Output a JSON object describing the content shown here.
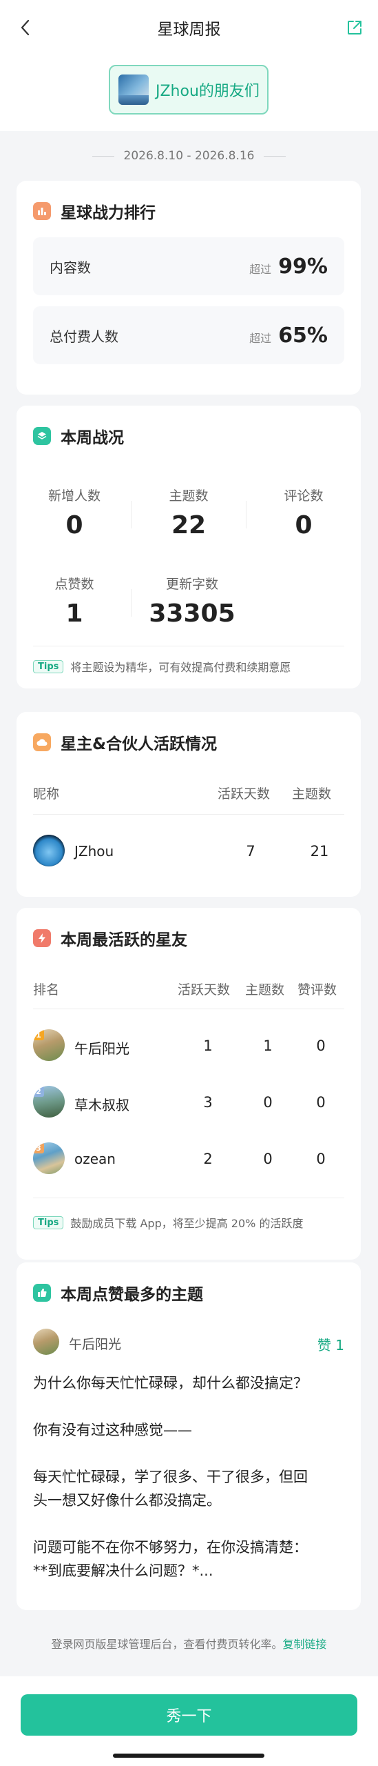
{
  "header": {
    "title": "星球周报",
    "back_icon": "chevron-left-icon",
    "share_icon": "share-external-icon"
  },
  "group": {
    "name": "JZhou的朋友们"
  },
  "date_range": "2026.8.10 - 2026.8.16",
  "ranking": {
    "title": "星球战力排行",
    "rows": [
      {
        "label": "内容数",
        "over": "超过",
        "pct": "99%"
      },
      {
        "label": "总付费人数",
        "over": "超过",
        "pct": "65%"
      }
    ]
  },
  "weekly": {
    "title": "本周战况",
    "stats": [
      {
        "label": "新增人数",
        "value": "0"
      },
      {
        "label": "主题数",
        "value": "22"
      },
      {
        "label": "评论数",
        "value": "0"
      },
      {
        "label": "点赞数",
        "value": "1"
      },
      {
        "label": "更新字数",
        "value": "33305"
      }
    ],
    "tip_tag": "Tips",
    "tip_text": "将主题设为精华，可有效提高付费和续期意愿"
  },
  "activity": {
    "title": "星主&合伙人活跃情况",
    "headers": {
      "name": "昵称",
      "days": "活跃天数",
      "topics": "主题数"
    },
    "rows": [
      {
        "name": "JZhou",
        "days": "7",
        "topics": "21"
      }
    ]
  },
  "active_members": {
    "title": "本周最活跃的星友",
    "headers": {
      "rank": "排名",
      "days": "活跃天数",
      "topics": "主题数",
      "likes": "赞评数"
    },
    "rows": [
      {
        "rank": "1",
        "name": "午后阳光",
        "days": "1",
        "topics": "1",
        "likes": "0"
      },
      {
        "rank": "2",
        "name": "草木叔叔",
        "days": "3",
        "topics": "0",
        "likes": "0"
      },
      {
        "rank": "3",
        "name": "ozean",
        "days": "2",
        "topics": "0",
        "likes": "0"
      }
    ],
    "tip_tag": "Tips",
    "tip_text": "鼓励成员下载 App，将至少提高 20% 的活跃度"
  },
  "top_post": {
    "title": "本周点赞最多的主题",
    "author": "午后阳光",
    "likes": "赞 1",
    "lines": [
      "为什么你每天忙忙碌碌，却什么都没搞定？",
      "你有没有过这种感觉——",
      "每天忙忙碌碌，学了很多、干了很多，但回",
      "头一想又好像什么都没搞定。",
      "问题可能不在你不够努力，在你没搞清楚：",
      "**到底要解决什么问题？*..."
    ]
  },
  "footer": {
    "note": "登录网页版星球管理后台，查看付费页转化率。",
    "link": "复制链接",
    "button": "秀一下"
  },
  "colors": {
    "accent": "#23c29c",
    "accent_text": "#16a983",
    "rank1": "#f5a623",
    "rank2": "#8fb2e0",
    "rank3": "#f0a35e"
  }
}
